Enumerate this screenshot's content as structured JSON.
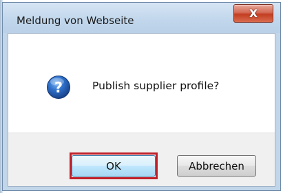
{
  "dialog": {
    "title": "Meldung von Webseite",
    "close_icon": "close-icon",
    "close_glyph": "X",
    "message": "Publish supplier profile?",
    "message_icon": "question-icon",
    "buttons": {
      "ok_label": "OK",
      "cancel_label": "Abbrechen"
    },
    "ok_highlighted": true
  },
  "colors": {
    "title_bar": "#c2d6ea",
    "close_button": "#c33e22",
    "highlight_border": "#c0202a",
    "question_icon": "#1f5fb8"
  }
}
